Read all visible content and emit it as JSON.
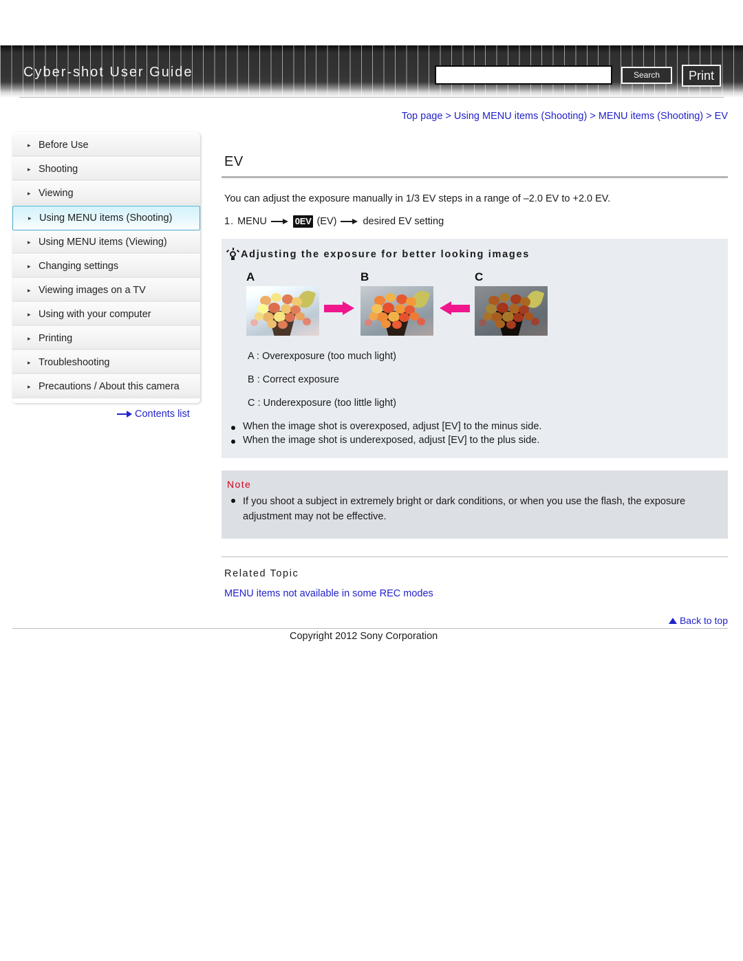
{
  "header": {
    "site_title": "Cyber-shot User Guide",
    "search_value": "",
    "search_placeholder": "",
    "search_button": "Search",
    "print_button": "Print"
  },
  "breadcrumb": {
    "text": "Top page > Using MENU items (Shooting) > MENU items (Shooting) > EV"
  },
  "sidebar": {
    "items": [
      {
        "label": "Before Use",
        "active": false
      },
      {
        "label": "Shooting",
        "active": false
      },
      {
        "label": "Viewing",
        "active": false
      },
      {
        "label": "Using MENU items (Shooting)",
        "active": true
      },
      {
        "label": "Using MENU items (Viewing)",
        "active": false
      },
      {
        "label": "Changing settings",
        "active": false
      },
      {
        "label": "Viewing images on a TV",
        "active": false
      },
      {
        "label": "Using with your computer",
        "active": false
      },
      {
        "label": "Printing",
        "active": false
      },
      {
        "label": "Troubleshooting",
        "active": false
      },
      {
        "label": "Precautions / About this camera",
        "active": false
      }
    ],
    "contents_link": "Contents list"
  },
  "main": {
    "title": "EV",
    "intro": "You can adjust the exposure manually in 1/3 EV steps in a range of –2.0 EV to +2.0 EV.",
    "step": {
      "number": "1.",
      "part1": "MENU",
      "icon_label": "0EV",
      "part2": "(EV)",
      "part3": "desired EV setting"
    },
    "tip": {
      "heading": "Adjusting the exposure for better looking images",
      "photos": [
        {
          "letter": "A",
          "variant": "over"
        },
        {
          "letter": "B",
          "variant": "correct"
        },
        {
          "letter": "C",
          "variant": "under"
        }
      ],
      "legend": [
        "A : Overexposure (too much light)",
        "B : Correct exposure",
        "C : Underexposure (too little light)"
      ],
      "bullets": [
        "When the image shot is overexposed, adjust [EV] to the minus side.",
        "When the image shot is underexposed, adjust [EV] to the plus side."
      ]
    },
    "note": {
      "title": "Note",
      "bullets": [
        "If you shoot a subject in extremely bright or dark conditions, or when you use the flash, the exposure adjustment may not be effective."
      ]
    },
    "related": {
      "title": "Related Topic",
      "links": [
        "MENU items not available in some REC modes"
      ]
    },
    "back_to_top": "Back to top"
  },
  "footer": {
    "copyright": "Copyright 2012 Sony Corporation"
  },
  "colors": {
    "link": "#2222cc",
    "note_title": "#d0021b",
    "arrow_pink": "#f0168c",
    "active_border": "#4aa8cc"
  }
}
